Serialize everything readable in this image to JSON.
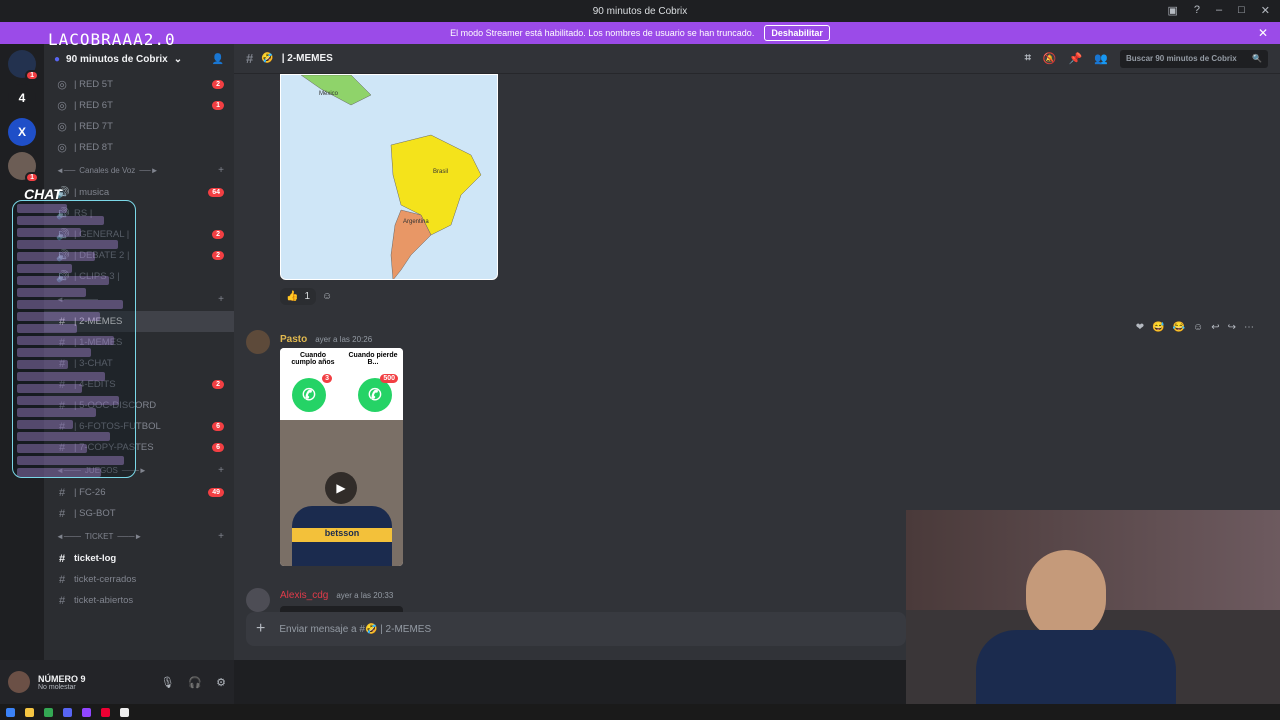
{
  "window": {
    "title": "90 minutos de Cobrix",
    "controls": [
      "▣",
      "?",
      "–",
      "□",
      "✕"
    ]
  },
  "banner": {
    "text": "El modo Streamer está habilitado. Los nombres de usuario se han truncado.",
    "button": "Deshabilitar",
    "close": "✕"
  },
  "stream_overlay": {
    "logo": "LACOBRAAA2.0",
    "chat_label": "CHAT"
  },
  "servers": [
    {
      "label": "4"
    },
    {
      "label": "X"
    }
  ],
  "server": {
    "name": "90 minutos de Cobrix",
    "chevron": "⌄"
  },
  "channels": {
    "red": [
      {
        "name": "| RED 5T",
        "badge": "2"
      },
      {
        "name": "| RED 6T",
        "badge": "1"
      },
      {
        "name": "| RED 7T",
        "badge": ""
      },
      {
        "name": "| RED 8T",
        "badge": ""
      }
    ],
    "voice_cat": "Canales de Voz",
    "voice": [
      {
        "name": "| musica",
        "badge": "64"
      },
      {
        "name": "RS |",
        "badge": ""
      },
      {
        "name": "| GENERAL |",
        "badge": "2"
      },
      {
        "name": "| DEBATE 2 |",
        "badge": "2"
      },
      {
        "name": "| CLIPS 3 |",
        "badge": ""
      }
    ],
    "text": [
      {
        "name": "| 2-MEMES",
        "badge": "",
        "sel": true
      },
      {
        "name": "| 1-MEMES",
        "badge": ""
      },
      {
        "name": "| 3-CHAT",
        "badge": ""
      },
      {
        "name": "| 4-EDITS",
        "badge": "2"
      },
      {
        "name": "| 5-OOC-DISCORD",
        "badge": ""
      },
      {
        "name": "| 6-FOTOS-FUTBOL",
        "badge": "6"
      },
      {
        "name": "| 7-COPY-PASTES",
        "badge": "6"
      }
    ],
    "juegos_cat": "JUEGOS",
    "juegos": [
      {
        "name": "| FC-26",
        "badge": "49"
      },
      {
        "name": "| SG-BOT",
        "badge": ""
      }
    ],
    "ticket_cat": "TICKET",
    "ticket": [
      {
        "name": "ticket-log",
        "unread": true
      },
      {
        "name": "ticket-cerrados"
      },
      {
        "name": "ticket-abiertos"
      }
    ]
  },
  "user": {
    "name": "NÚMERO 9",
    "status": "No molestar"
  },
  "header": {
    "channel": "| 2-MEMES",
    "search_placeholder": "Buscar 90 minutos de Cobrix"
  },
  "map_labels": {
    "mexico": "México",
    "brasil": "Brasil",
    "argentina": "Argentina"
  },
  "reactions": [
    {
      "emoji": "👍",
      "count": "1"
    }
  ],
  "messages": [
    {
      "author": "Pasto",
      "time": "ayer a las 20:26",
      "meme_left": "Cuando cumplo años",
      "meme_right": "Cuando pierde B...",
      "count_left": "3",
      "count_right": "500",
      "shirt": "betsson"
    },
    {
      "author": "Alexis_cdg",
      "time": "ayer a las 20:33"
    }
  ],
  "composer": {
    "placeholder": "Enviar mensaje a #🤣 | 2-MEMES"
  },
  "colors": {
    "accent": "#9b4be8",
    "badge": "#f23f43",
    "bg": "#313338"
  }
}
